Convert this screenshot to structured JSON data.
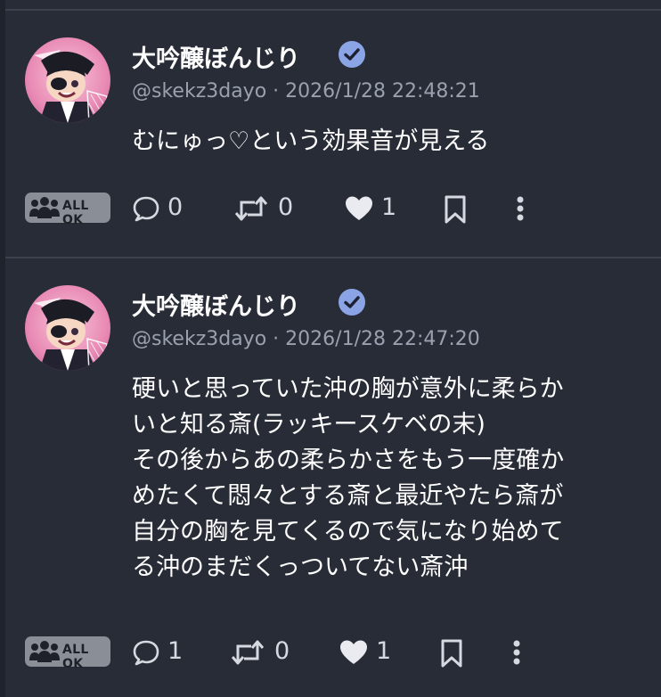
{
  "posts": [
    {
      "display_name": "大吟醸ぼんじり",
      "handle": "@skekz3dayo",
      "separator": "·",
      "timestamp": "2026/1/28 22:48:21",
      "lines": [
        "むにゅっ♡という効果音が見える"
      ],
      "visibility": "ALL OK",
      "replies": "0",
      "reblogs": "0",
      "likes": "1"
    },
    {
      "display_name": "大吟醸ぼんじり",
      "handle": "@skekz3dayo",
      "separator": "·",
      "timestamp": "2026/1/28 22:47:20",
      "lines": [
        "硬いと思っていた沖の胸が意外に柔らか",
        "いと知る斎(ラッキースケベの末)",
        "その後からあの柔らかさをもう一度確か",
        "めたくて悶々とする斎と最近やたら斎が",
        "自分の胸を見てくるので気になり始めて",
        "る沖のまだくっついてない斎沖"
      ],
      "visibility": "ALL OK",
      "replies": "1",
      "reblogs": "0",
      "likes": "1"
    }
  ],
  "icons": {
    "verified": "verified-check-icon",
    "reply": "speech-bubble-icon",
    "reblog": "repeat-icon",
    "like": "heart-icon",
    "bookmark": "bookmark-icon",
    "more": "vertical-dots-icon",
    "visibility": "people-icon"
  },
  "colors": {
    "background": "#282c37",
    "text": "#ffffff",
    "meta": "#9aa0ae",
    "verified": "#8aa4e6",
    "badge": "#8a8e97"
  }
}
